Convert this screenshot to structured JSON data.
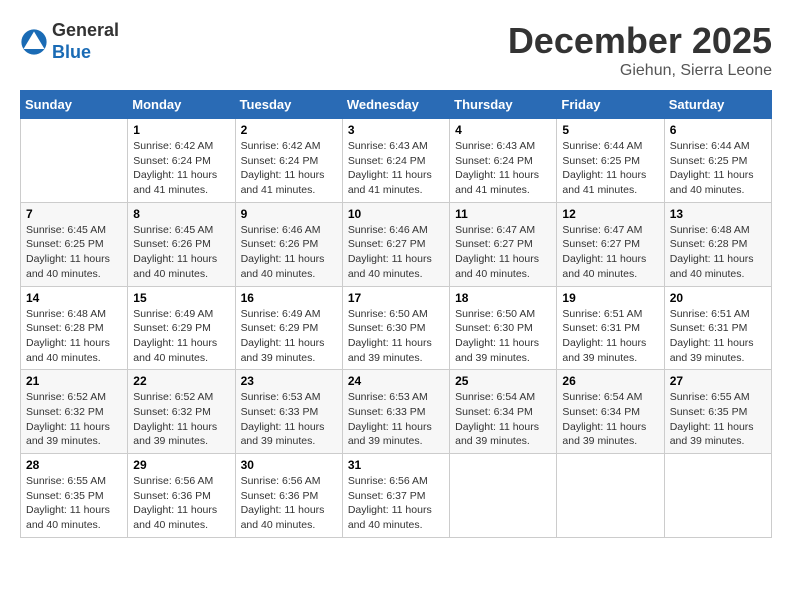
{
  "logo": {
    "general": "General",
    "blue": "Blue"
  },
  "header": {
    "month": "December 2025",
    "location": "Giehun, Sierra Leone"
  },
  "weekdays": [
    "Sunday",
    "Monday",
    "Tuesday",
    "Wednesday",
    "Thursday",
    "Friday",
    "Saturday"
  ],
  "weeks": [
    [
      {
        "day": "",
        "sunrise": "",
        "sunset": "",
        "daylight": ""
      },
      {
        "day": "1",
        "sunrise": "Sunrise: 6:42 AM",
        "sunset": "Sunset: 6:24 PM",
        "daylight": "Daylight: 11 hours and 41 minutes."
      },
      {
        "day": "2",
        "sunrise": "Sunrise: 6:42 AM",
        "sunset": "Sunset: 6:24 PM",
        "daylight": "Daylight: 11 hours and 41 minutes."
      },
      {
        "day": "3",
        "sunrise": "Sunrise: 6:43 AM",
        "sunset": "Sunset: 6:24 PM",
        "daylight": "Daylight: 11 hours and 41 minutes."
      },
      {
        "day": "4",
        "sunrise": "Sunrise: 6:43 AM",
        "sunset": "Sunset: 6:24 PM",
        "daylight": "Daylight: 11 hours and 41 minutes."
      },
      {
        "day": "5",
        "sunrise": "Sunrise: 6:44 AM",
        "sunset": "Sunset: 6:25 PM",
        "daylight": "Daylight: 11 hours and 41 minutes."
      },
      {
        "day": "6",
        "sunrise": "Sunrise: 6:44 AM",
        "sunset": "Sunset: 6:25 PM",
        "daylight": "Daylight: 11 hours and 40 minutes."
      }
    ],
    [
      {
        "day": "7",
        "sunrise": "Sunrise: 6:45 AM",
        "sunset": "Sunset: 6:25 PM",
        "daylight": "Daylight: 11 hours and 40 minutes."
      },
      {
        "day": "8",
        "sunrise": "Sunrise: 6:45 AM",
        "sunset": "Sunset: 6:26 PM",
        "daylight": "Daylight: 11 hours and 40 minutes."
      },
      {
        "day": "9",
        "sunrise": "Sunrise: 6:46 AM",
        "sunset": "Sunset: 6:26 PM",
        "daylight": "Daylight: 11 hours and 40 minutes."
      },
      {
        "day": "10",
        "sunrise": "Sunrise: 6:46 AM",
        "sunset": "Sunset: 6:27 PM",
        "daylight": "Daylight: 11 hours and 40 minutes."
      },
      {
        "day": "11",
        "sunrise": "Sunrise: 6:47 AM",
        "sunset": "Sunset: 6:27 PM",
        "daylight": "Daylight: 11 hours and 40 minutes."
      },
      {
        "day": "12",
        "sunrise": "Sunrise: 6:47 AM",
        "sunset": "Sunset: 6:27 PM",
        "daylight": "Daylight: 11 hours and 40 minutes."
      },
      {
        "day": "13",
        "sunrise": "Sunrise: 6:48 AM",
        "sunset": "Sunset: 6:28 PM",
        "daylight": "Daylight: 11 hours and 40 minutes."
      }
    ],
    [
      {
        "day": "14",
        "sunrise": "Sunrise: 6:48 AM",
        "sunset": "Sunset: 6:28 PM",
        "daylight": "Daylight: 11 hours and 40 minutes."
      },
      {
        "day": "15",
        "sunrise": "Sunrise: 6:49 AM",
        "sunset": "Sunset: 6:29 PM",
        "daylight": "Daylight: 11 hours and 40 minutes."
      },
      {
        "day": "16",
        "sunrise": "Sunrise: 6:49 AM",
        "sunset": "Sunset: 6:29 PM",
        "daylight": "Daylight: 11 hours and 39 minutes."
      },
      {
        "day": "17",
        "sunrise": "Sunrise: 6:50 AM",
        "sunset": "Sunset: 6:30 PM",
        "daylight": "Daylight: 11 hours and 39 minutes."
      },
      {
        "day": "18",
        "sunrise": "Sunrise: 6:50 AM",
        "sunset": "Sunset: 6:30 PM",
        "daylight": "Daylight: 11 hours and 39 minutes."
      },
      {
        "day": "19",
        "sunrise": "Sunrise: 6:51 AM",
        "sunset": "Sunset: 6:31 PM",
        "daylight": "Daylight: 11 hours and 39 minutes."
      },
      {
        "day": "20",
        "sunrise": "Sunrise: 6:51 AM",
        "sunset": "Sunset: 6:31 PM",
        "daylight": "Daylight: 11 hours and 39 minutes."
      }
    ],
    [
      {
        "day": "21",
        "sunrise": "Sunrise: 6:52 AM",
        "sunset": "Sunset: 6:32 PM",
        "daylight": "Daylight: 11 hours and 39 minutes."
      },
      {
        "day": "22",
        "sunrise": "Sunrise: 6:52 AM",
        "sunset": "Sunset: 6:32 PM",
        "daylight": "Daylight: 11 hours and 39 minutes."
      },
      {
        "day": "23",
        "sunrise": "Sunrise: 6:53 AM",
        "sunset": "Sunset: 6:33 PM",
        "daylight": "Daylight: 11 hours and 39 minutes."
      },
      {
        "day": "24",
        "sunrise": "Sunrise: 6:53 AM",
        "sunset": "Sunset: 6:33 PM",
        "daylight": "Daylight: 11 hours and 39 minutes."
      },
      {
        "day": "25",
        "sunrise": "Sunrise: 6:54 AM",
        "sunset": "Sunset: 6:34 PM",
        "daylight": "Daylight: 11 hours and 39 minutes."
      },
      {
        "day": "26",
        "sunrise": "Sunrise: 6:54 AM",
        "sunset": "Sunset: 6:34 PM",
        "daylight": "Daylight: 11 hours and 39 minutes."
      },
      {
        "day": "27",
        "sunrise": "Sunrise: 6:55 AM",
        "sunset": "Sunset: 6:35 PM",
        "daylight": "Daylight: 11 hours and 39 minutes."
      }
    ],
    [
      {
        "day": "28",
        "sunrise": "Sunrise: 6:55 AM",
        "sunset": "Sunset: 6:35 PM",
        "daylight": "Daylight: 11 hours and 40 minutes."
      },
      {
        "day": "29",
        "sunrise": "Sunrise: 6:56 AM",
        "sunset": "Sunset: 6:36 PM",
        "daylight": "Daylight: 11 hours and 40 minutes."
      },
      {
        "day": "30",
        "sunrise": "Sunrise: 6:56 AM",
        "sunset": "Sunset: 6:36 PM",
        "daylight": "Daylight: 11 hours and 40 minutes."
      },
      {
        "day": "31",
        "sunrise": "Sunrise: 6:56 AM",
        "sunset": "Sunset: 6:37 PM",
        "daylight": "Daylight: 11 hours and 40 minutes."
      },
      {
        "day": "",
        "sunrise": "",
        "sunset": "",
        "daylight": ""
      },
      {
        "day": "",
        "sunrise": "",
        "sunset": "",
        "daylight": ""
      },
      {
        "day": "",
        "sunrise": "",
        "sunset": "",
        "daylight": ""
      }
    ]
  ]
}
